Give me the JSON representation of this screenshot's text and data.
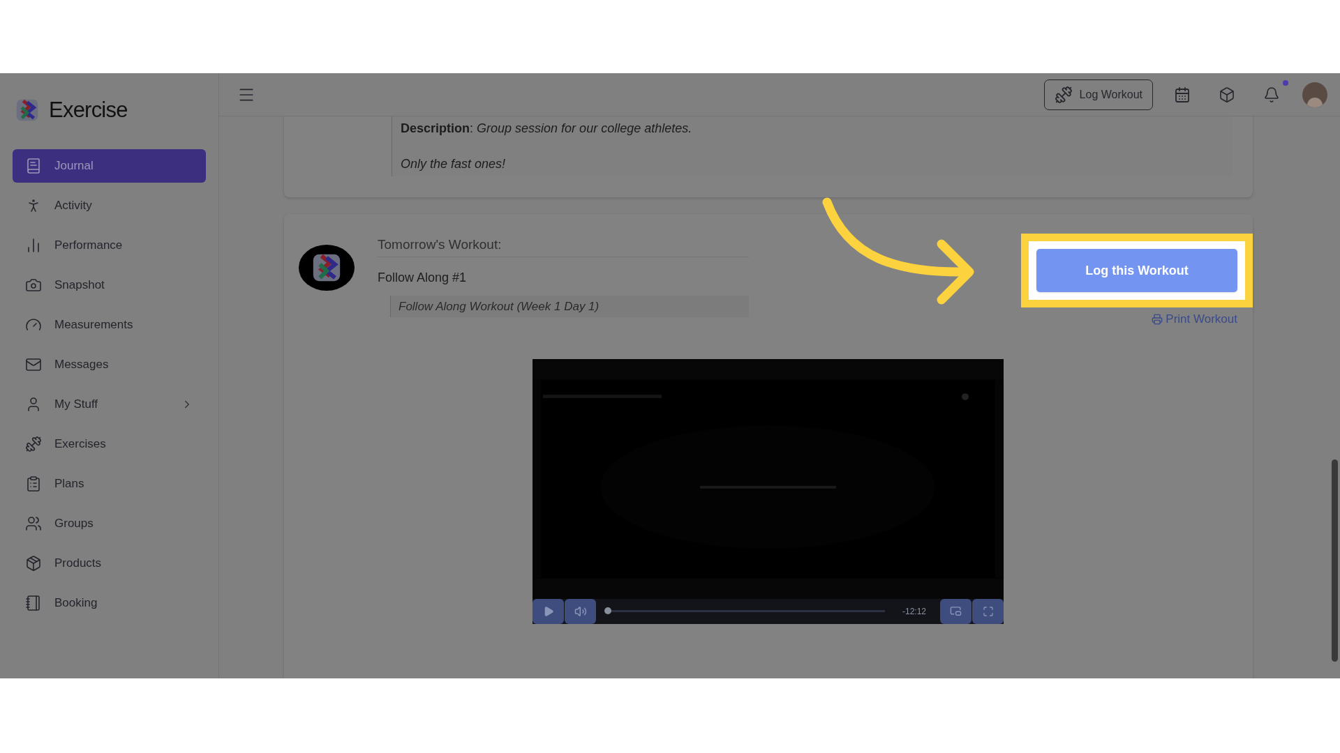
{
  "sidebar": {
    "brand": "Exercise",
    "items": [
      {
        "label": "Journal",
        "selected": true,
        "expandable": false
      },
      {
        "label": "Activity",
        "selected": false,
        "expandable": false
      },
      {
        "label": "Performance",
        "selected": false,
        "expandable": false
      },
      {
        "label": "Snapshot",
        "selected": false,
        "expandable": false
      },
      {
        "label": "Measurements",
        "selected": false,
        "expandable": false
      },
      {
        "label": "Messages",
        "selected": false,
        "expandable": false
      },
      {
        "label": "My Stuff",
        "selected": false,
        "expandable": true
      },
      {
        "label": "Exercises",
        "selected": false,
        "expandable": false
      },
      {
        "label": "Plans",
        "selected": false,
        "expandable": false
      },
      {
        "label": "Groups",
        "selected": false,
        "expandable": false
      },
      {
        "label": "Products",
        "selected": false,
        "expandable": false
      },
      {
        "label": "Booking",
        "selected": false,
        "expandable": false
      }
    ]
  },
  "header": {
    "log_button": "Log Workout",
    "notification": true
  },
  "event": {
    "description": "**Description**: *Group session for our college athletes.*",
    "note": "Only the fast ones!"
  },
  "workout": {
    "heading": "Tomorrow's Workout:",
    "name": "Follow Along #1",
    "summary": "Follow Along Workout (Week 1 Day 1)",
    "log_button": "Log this Workout",
    "print_link": "Print Workout",
    "video": {
      "time": "-12:12",
      "level": 0
    }
  }
}
